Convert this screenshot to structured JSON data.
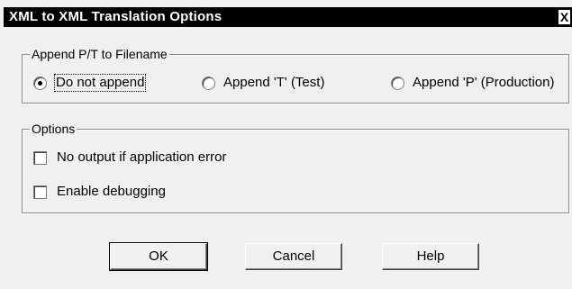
{
  "window": {
    "title": "XML to XML Translation Options",
    "close_glyph": "X"
  },
  "append_group": {
    "legend": "Append P/T to Filename",
    "options": [
      {
        "label": "Do not append",
        "selected": true
      },
      {
        "label": "Append 'T' (Test)",
        "selected": false
      },
      {
        "label": "Append 'P' (Production)",
        "selected": false
      }
    ]
  },
  "options_group": {
    "legend": "Options",
    "checkboxes": [
      {
        "label": "No output if application error",
        "checked": false
      },
      {
        "label": "Enable debugging",
        "checked": false
      }
    ]
  },
  "buttons": {
    "ok": "OK",
    "cancel": "Cancel",
    "help": "Help"
  }
}
